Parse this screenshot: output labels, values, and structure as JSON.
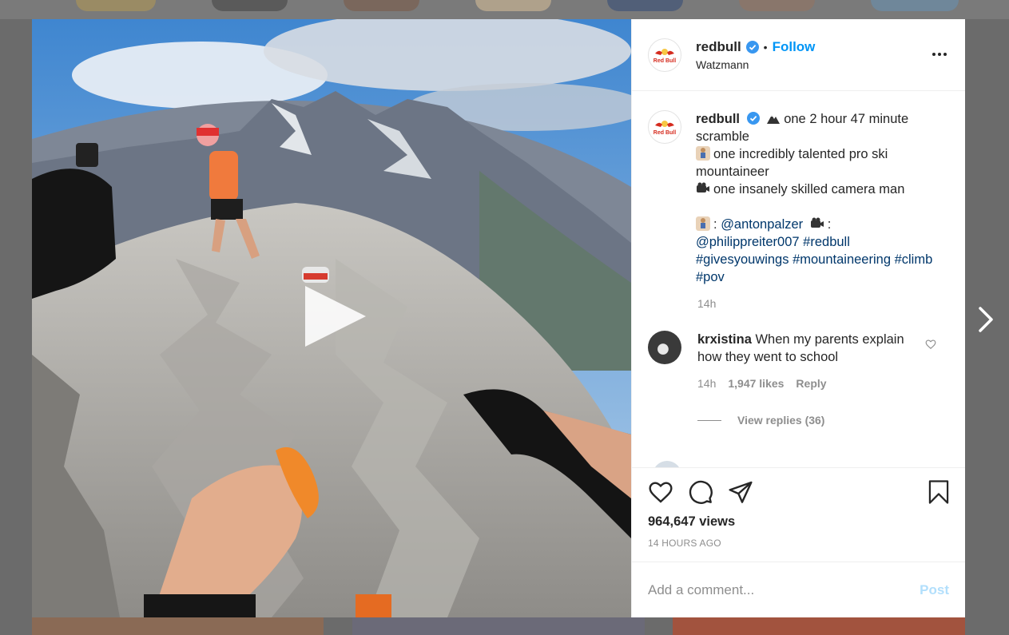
{
  "post": {
    "username": "redbull",
    "follow_label": "Follow",
    "separator": "•",
    "location": "Watzmann",
    "caption": {
      "line1": "one 2 hour 47 minute scramble",
      "line2": "one incredibly talented pro ski mountaineer",
      "line3": "one insanely skilled camera man",
      "credit_sep1": ":",
      "mention1": "@antonpalzer",
      "credit_sep2": ":",
      "mention2": "@philippreiter007",
      "hashtag1": "#redbull",
      "hashtag2": "#givesyouwings",
      "hashtag3": "#mountaineering",
      "hashtag4": "#climb",
      "hashtag5": "#pov",
      "time": "14h"
    },
    "comment": {
      "username": "krxistina",
      "text": "When my parents explain how they went to school",
      "time": "14h",
      "likes": "1,947 likes",
      "reply_label": "Reply",
      "view_replies": "View replies (36)"
    },
    "views": "964,647 views",
    "date": "14 HOURS AGO",
    "add_comment_placeholder": "Add a comment...",
    "post_label": "Post",
    "brand_logo_text": "Red Bull"
  },
  "colors": {
    "accent": "#0095f6",
    "link": "#00376b",
    "muted": "#8e8e8e",
    "post_disabled": "#b2dffc"
  }
}
